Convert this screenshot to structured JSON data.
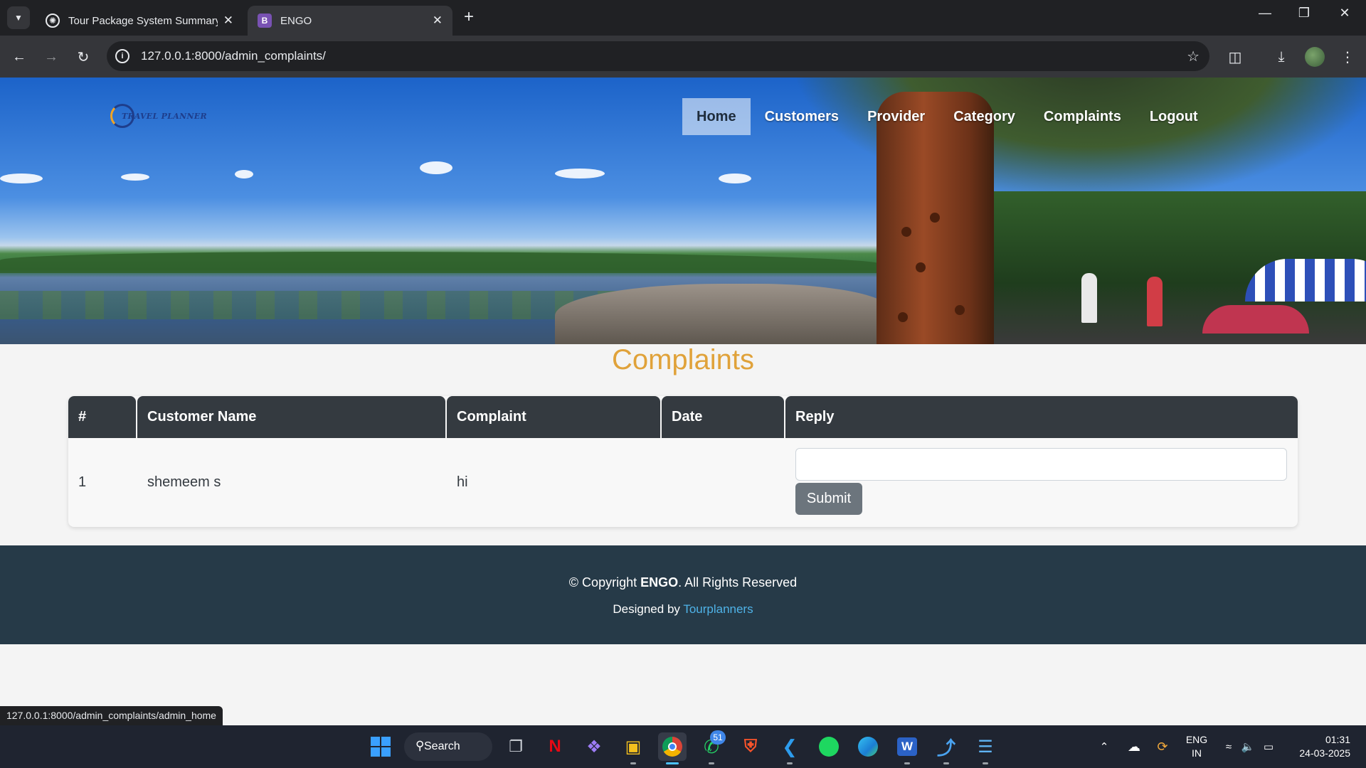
{
  "browser": {
    "tabs": [
      {
        "title": "Tour Package System Summary",
        "favicon": "chatgpt-icon",
        "active": false
      },
      {
        "title": "ENGO",
        "favicon": "bootstrap-icon",
        "favicon_letter": "B",
        "active": true
      }
    ],
    "url": "127.0.0.1:8000/admin_complaints/",
    "status_url": "127.0.0.1:8000/admin_complaints/admin_home"
  },
  "site": {
    "logo_text": "TRAVEL PLANNER",
    "nav": [
      {
        "label": "Home",
        "active": true
      },
      {
        "label": "Customers",
        "active": false
      },
      {
        "label": "Provider",
        "active": false
      },
      {
        "label": "Category",
        "active": false
      },
      {
        "label": "Complaints",
        "active": false
      },
      {
        "label": "Logout",
        "active": false
      }
    ]
  },
  "page": {
    "title": "Complaints",
    "table": {
      "headers": [
        "#",
        "Customer Name",
        "Complaint",
        "Date",
        "Reply"
      ],
      "rows": [
        {
          "num": "1",
          "customer_name": "shemeem s",
          "complaint": "hi",
          "date": "",
          "reply_value": "",
          "submit_label": "Submit"
        }
      ]
    }
  },
  "footer": {
    "copyright_prefix": "© Copyright ",
    "brand": "ENGO",
    "copyright_suffix": ". All Rights Reserved",
    "designed_by": "Designed by ",
    "designer": "Tourplanners"
  },
  "taskbar": {
    "search_label": "Search",
    "whatsapp_badge": "51",
    "lang_line1": "ENG",
    "lang_line2": "IN",
    "time": "01:31",
    "date": "24-03-2025"
  },
  "colors": {
    "title_accent": "#e0a23a",
    "table_header": "#343a40",
    "footer_bg": "#263a48",
    "link": "#4fb3e8",
    "submit_button": "#6c757d"
  }
}
